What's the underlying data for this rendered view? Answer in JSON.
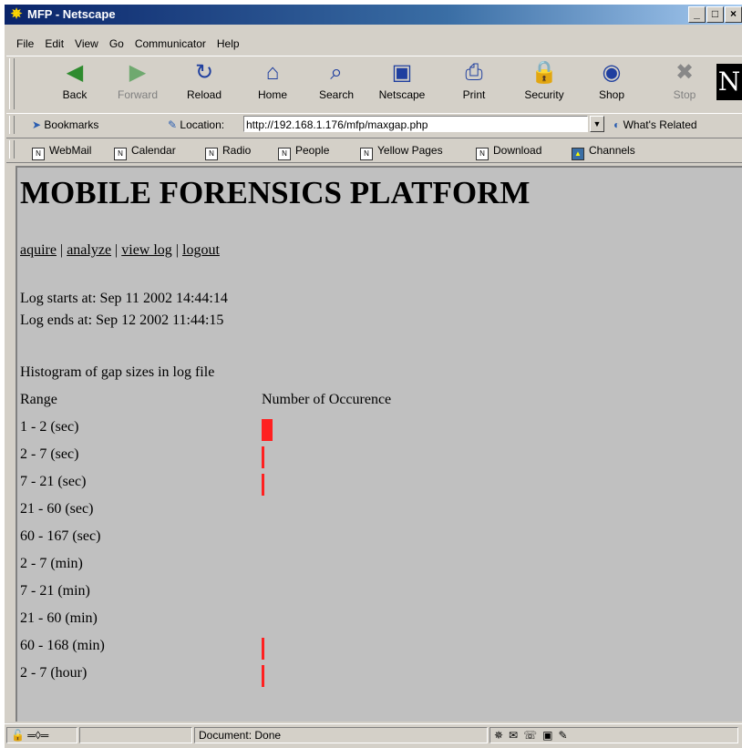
{
  "window": {
    "title": "MFP - Netscape",
    "buttons": [
      "_",
      "□",
      "×"
    ]
  },
  "menu": [
    "File",
    "Edit",
    "View",
    "Go",
    "Communicator",
    "Help"
  ],
  "nav": [
    {
      "label": "Back",
      "icon": "back-arrow-icon",
      "glyph": "◀",
      "color": "#2e8b2e",
      "disabled": false
    },
    {
      "label": "Forward",
      "icon": "forward-arrow-icon",
      "glyph": "▶",
      "color": "#6fa96f",
      "disabled": true
    },
    {
      "label": "Reload",
      "icon": "reload-icon",
      "glyph": "↻",
      "color": "#1f3f9f",
      "disabled": false
    },
    {
      "label": "Home",
      "icon": "home-icon",
      "glyph": "⌂",
      "color": "#1f3f9f",
      "disabled": false
    },
    {
      "label": "Search",
      "icon": "search-icon",
      "glyph": "⌕",
      "color": "#1f3f9f",
      "disabled": false
    },
    {
      "label": "Netscape",
      "icon": "my-netscape-icon",
      "glyph": "▣",
      "color": "#1f3f9f",
      "disabled": false
    },
    {
      "label": "Print",
      "icon": "print-icon",
      "glyph": "⎙",
      "color": "#1f3f9f",
      "disabled": false
    },
    {
      "label": "Security",
      "icon": "security-lock-icon",
      "glyph": "🔒",
      "color": "#555",
      "disabled": false
    },
    {
      "label": "Shop",
      "icon": "shop-icon",
      "glyph": "◉",
      "color": "#1f3f9f",
      "disabled": false
    },
    {
      "label": "Stop",
      "icon": "stop-icon",
      "glyph": "✖",
      "color": "#888",
      "disabled": true
    }
  ],
  "location": {
    "bookmarks_label": "Bookmarks",
    "label": "Location:",
    "url": "http://192.168.1.176/mfp/maxgap.php",
    "related_label": "What's Related"
  },
  "personal": [
    "WebMail",
    "Calendar",
    "Radio",
    "People",
    "Yellow Pages",
    "Download",
    "Channels"
  ],
  "page": {
    "heading": "MOBILE FORENSICS PLATFORM",
    "links": [
      "aquire",
      "analyze",
      "view log",
      "logout"
    ],
    "separator": " | ",
    "log_start": "Log starts at: Sep 11 2002 14:44:14",
    "log_end": "Log ends at: Sep 12 2002 11:44:15",
    "hist_title": "Histogram of gap sizes in log file",
    "col_range": "Range",
    "col_count": "Number of Occurence",
    "bar_color": "#ff2020"
  },
  "chart_data": {
    "type": "bar",
    "title": "Histogram of gap sizes in log file",
    "xlabel": "Range",
    "ylabel": "Number of Occurence",
    "categories": [
      "1 - 2 (sec)",
      "2 - 7 (sec)",
      "7 - 21 (sec)",
      "21 - 60 (sec)",
      "60 - 167 (sec)",
      "2 - 7 (min)",
      "7 - 21 (min)",
      "21 - 60 (min)",
      "60 - 168 (min)",
      "2 - 7 (hour)"
    ],
    "values": [
      4,
      1,
      1,
      0,
      0,
      0,
      0,
      0,
      1,
      1
    ]
  },
  "status": {
    "text": "Document: Done"
  }
}
